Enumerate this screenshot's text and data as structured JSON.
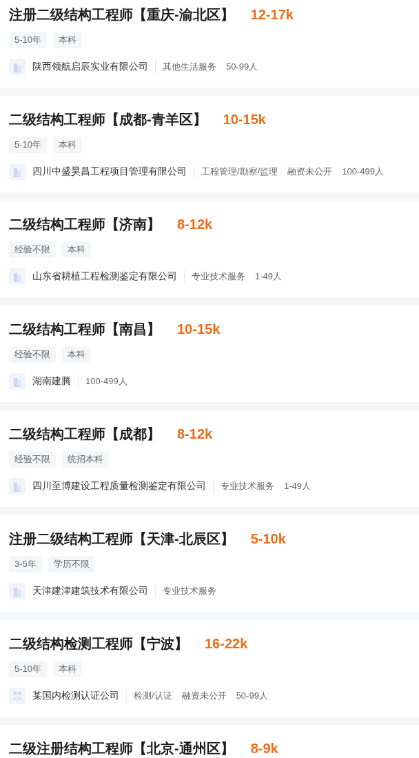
{
  "jobs": [
    {
      "title": "注册二级结构工程师【重庆-渝北区】",
      "salary": "12-17k",
      "tags": [
        "5-10年",
        "本科"
      ],
      "company": {
        "name": "陕西领航启辰实业有限公司",
        "logo": {
          "kind": "building"
        },
        "details": [
          "其他生活服务",
          "50-99人"
        ]
      }
    },
    {
      "title": "二级结构工程师【成都-青羊区】",
      "salary": "10-15k",
      "tags": [
        "5-10年",
        "本科"
      ],
      "company": {
        "name": "四川中盛昊昌工程项目管理有限公司",
        "logo": {
          "kind": "building"
        },
        "details": [
          "工程管理/勘察/监理",
          "融资未公开",
          "100-499人"
        ]
      }
    },
    {
      "title": "二级结构工程师【济南】",
      "salary": "8-12k",
      "tags": [
        "经验不限",
        "本科"
      ],
      "company": {
        "name": "山东省耕植工程检测鉴定有限公司",
        "logo": {
          "kind": "building"
        },
        "details": [
          "专业技术服务",
          "1-49人"
        ]
      }
    },
    {
      "title": "二级结构工程师【南昌】",
      "salary": "10-15k",
      "tags": [
        "经验不限",
        "本科"
      ],
      "company": {
        "name": "湖南建腾",
        "logo": {
          "kind": "building"
        },
        "details": [
          "100-499人"
        ]
      }
    },
    {
      "title": "二级结构工程师【成都】",
      "salary": "8-12k",
      "tags": [
        "经验不限",
        "统招本科"
      ],
      "company": {
        "name": "四川至博建设工程质量检测鉴定有限公司",
        "logo": {
          "kind": "building"
        },
        "details": [
          "专业技术服务",
          "1-49人"
        ]
      }
    },
    {
      "title": "注册二级结构工程师【天津-北辰区】",
      "salary": "5-10k",
      "tags": [
        "3-5年",
        "学历不限"
      ],
      "company": {
        "name": "天津建津建筑技术有限公司",
        "logo": {
          "kind": "building"
        },
        "details": [
          "专业技术服务"
        ]
      }
    },
    {
      "title": "二级结构检测工程师【宁波】",
      "salary": "16-22k",
      "tags": [
        "5-10年",
        "本科"
      ],
      "company": {
        "name": "某国内检测认证公司",
        "logo": {
          "kind": "blocks"
        },
        "details": [
          "检测/认证",
          "融资未公开",
          "50-99人"
        ]
      }
    },
    {
      "title": "二级注册结构工程师【北京-通州区】",
      "salary": "8-9k"
    }
  ]
}
